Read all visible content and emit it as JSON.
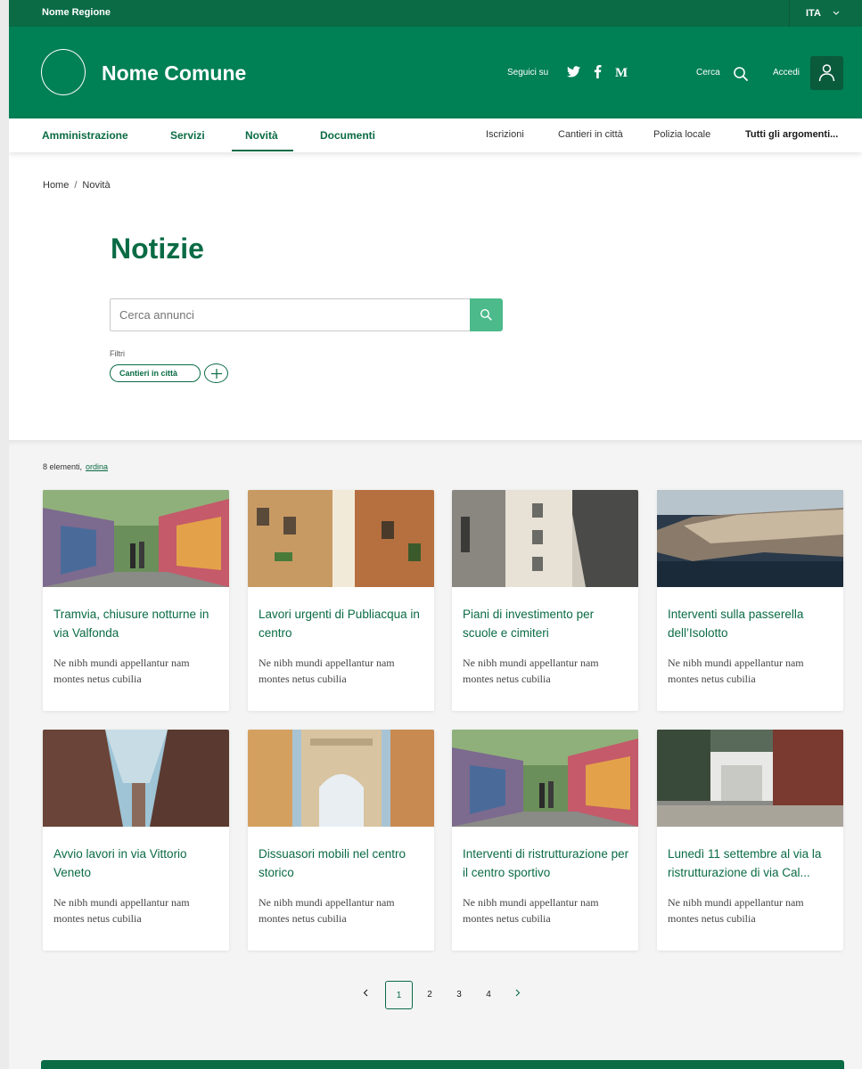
{
  "header": {
    "region": "Nome Regione",
    "language": "ITA",
    "site_name": "Nome Comune",
    "follow_label": "Seguici su",
    "social": [
      "twitter-icon",
      "facebook-icon",
      "medium-icon"
    ],
    "search_label": "Cerca",
    "login_label": "Accedi"
  },
  "nav": {
    "main": [
      "Amministrazione",
      "Servizi",
      "Novità",
      "Documenti"
    ],
    "active": "Novità",
    "secondary": [
      "Iscrizioni",
      "Cantieri in città",
      "Polizia locale"
    ],
    "all_topics": "Tutti gli argomenti..."
  },
  "breadcrumb": [
    "Home",
    "Novità"
  ],
  "page_title": "Notizie",
  "search": {
    "placeholder": "Cerca annunci"
  },
  "filters": {
    "label": "Filtri",
    "chips": [
      "Cantieri in città"
    ]
  },
  "results": {
    "count_text": "8 elementi,",
    "sort_link": "ordina"
  },
  "cards": [
    {
      "title": "Tramvia, chiusure notturne in via Valfonda",
      "desc": "Ne nibh mundi appellantur nam montes netus cubilia"
    },
    {
      "title": "Lavori urgenti di Publiacqua in centro",
      "desc": "Ne nibh mundi appellantur nam montes netus cubilia"
    },
    {
      "title": "Piani di investimento per scuole e cimiteri",
      "desc": "Ne nibh mundi appellantur nam montes netus cubilia"
    },
    {
      "title": "Interventi sulla passerella dell’Isolotto",
      "desc": "Ne nibh mundi appellantur nam montes netus cubilia"
    },
    {
      "title": "Avvio lavori in via Vittorio Veneto",
      "desc": "Ne nibh mundi appellantur nam montes netus cubilia"
    },
    {
      "title": "Dissuasori mobili nel centro storico",
      "desc": "Ne nibh mundi appellantur nam montes netus cubilia"
    },
    {
      "title": "Interventi di ristrutturazione per il centro sportivo",
      "desc": "Ne nibh mundi appellantur nam montes netus cubilia"
    },
    {
      "title": "Lunedì 11 settembre al via la ristrutturazione di via Cal...",
      "desc": "Ne nibh mundi appellantur nam montes netus cubilia"
    }
  ],
  "pagination": {
    "pages": [
      "1",
      "2",
      "3",
      "4"
    ],
    "current": "1"
  },
  "colors": {
    "primary": "#008055",
    "dark": "#0a6b45",
    "search_button": "#4dba8c"
  }
}
